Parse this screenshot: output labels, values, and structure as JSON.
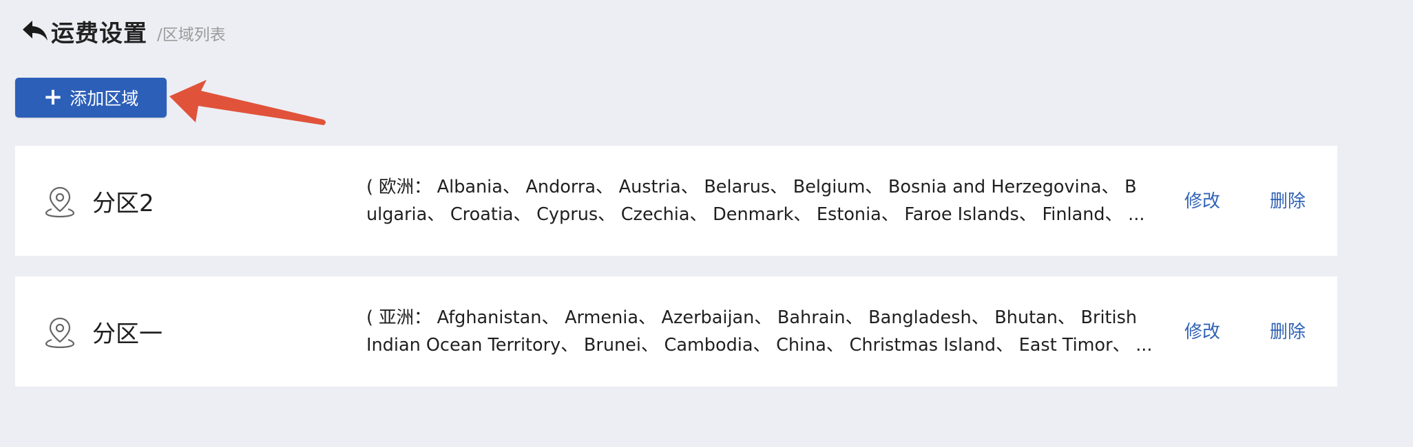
{
  "header": {
    "title": "运费设置",
    "breadcrumb": "/区域列表",
    "back_icon": "back-arrow-icon"
  },
  "toolbar": {
    "add_label": "添加区域",
    "add_icon": "plus-icon",
    "accent_color": "#2c5fb8"
  },
  "annotation": {
    "arrow_color": "#e0533a"
  },
  "zones": [
    {
      "name": "分区2",
      "countries_line1": "( 欧洲： Albania、 Andorra、 Austria、 Belarus、 Belgium、 Bosnia and Herzegovina、 B",
      "countries_line2": "ulgaria、 Croatia、 Cyprus、 Czechia、 Denmark、 Estonia、 Faroe Islands、 Finland、 ...",
      "edit_label": "修改",
      "delete_label": "删除",
      "icon": "location-pin-icon"
    },
    {
      "name": "分区一",
      "countries_line1": "( 亚洲： Afghanistan、 Armenia、 Azerbaijan、 Bahrain、 Bangladesh、 Bhutan、 British",
      "countries_line2": "Indian Ocean Territory、 Brunei、 Cambodia、 China、 Christmas Island、 East Timor、 ...",
      "edit_label": "修改",
      "delete_label": "删除",
      "icon": "location-pin-icon"
    }
  ]
}
